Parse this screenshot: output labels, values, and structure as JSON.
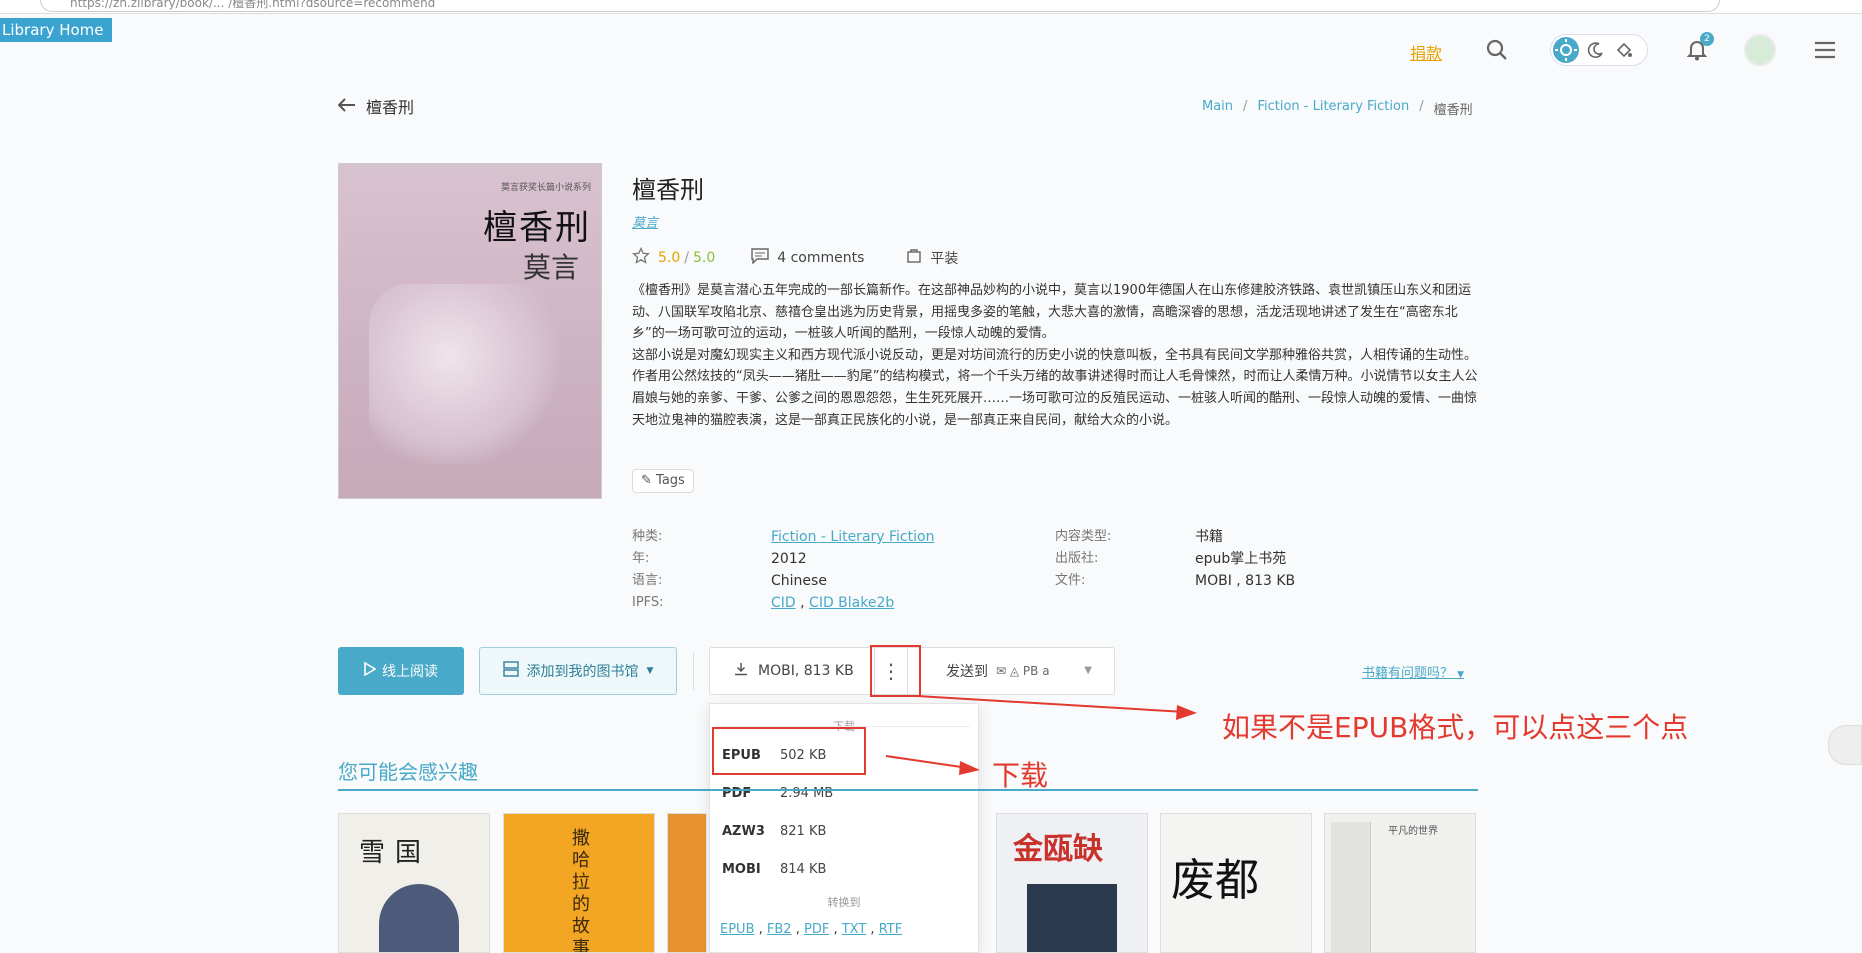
{
  "browser": {
    "url": "https://zh.zlibrary/book/... /檀香刑.html?dsource=recommend"
  },
  "library_home": "Library Home",
  "header": {
    "donate": "捐款",
    "notification_count": "2"
  },
  "page": {
    "back_title": "檀香刑",
    "breadcrumb": [
      "Main",
      "Fiction - Literary Fiction",
      "檀香刑"
    ]
  },
  "book": {
    "cover": {
      "top_text": "莫言获奖长篇小说系列",
      "title": "檀香刑",
      "author_sig": "莫言"
    },
    "title": "檀香刑",
    "author": "莫言",
    "rating": "5.0",
    "rating_sep": "/",
    "rating2": "5.0",
    "comments": "4 comments",
    "format_label": "平装",
    "description": [
      "《檀香刑》是莫言潜心五年完成的一部长篇新作。在这部神品妙构的小说中，莫言以1900年德国人在山东修建胶济铁路、袁世凯镇压山东义和团运动、八国联军攻陷北京、慈禧仓皇出逃为历史背景，用摇曳多姿的笔触，大悲大喜的激情，高瞻深睿的思想，活龙活现地讲述了发生在“高密东北乡”的一场可歌可泣的运动，一桩骇人听闻的酷刑，一段惊人动魄的爱情。",
      "这部小说是对魔幻现实主义和西方现代派小说反动，更是对坊间流行的历史小说的快意叫板，全书具有民间文学那种雅俗共赏，人相传诵的生动性。作者用公然炫技的“凤头——猪肚——豹尾”的结构模式，将一个千头万绪的故事讲述得时而让人毛骨悚然，时而让人柔情万种。小说情节以女主人公眉娘与她的亲爹、干爹、公爹之间的恩恩怨怨，生生死死展开……一场可歌可泣的反殖民运动、一桩骇人听闻的酷刑、一段惊人动魄的爱情、一曲惊天地泣鬼神的猫腔表演，这是一部真正民族化的小说，是一部真正来自民间，献给大众的小说。"
    ],
    "tags_label": "Tags",
    "props_left": {
      "category_label": "种类:",
      "category_value": "Fiction - Literary Fiction",
      "year_label": "年:",
      "year_value": "2012",
      "language_label": "语言:",
      "language_value": "Chinese",
      "ipfs_label": "IPFS:",
      "ipfs_cid": "CID",
      "ipfs_sep": " , ",
      "ipfs_blake": "CID Blake2b"
    },
    "props_right": {
      "content_type_label": "内容类型:",
      "content_type_value": "书籍",
      "publisher_label": "出版社:",
      "publisher_value": "epub掌上书苑",
      "file_label": "文件:",
      "file_value": "MOBI , 813 KB"
    }
  },
  "actions": {
    "read_online": "线上阅读",
    "add_to_shelf": "添加到我的图书馆",
    "download": "MOBI, 813 KB",
    "send_to": "发送到",
    "send_targets": "✉ ◬ PB a",
    "problem": "书籍有问题吗？"
  },
  "dropdown": {
    "header": "下载",
    "items": [
      {
        "format": "EPUB",
        "size": "502 KB"
      },
      {
        "format": "PDF",
        "size": "2.94 MB"
      },
      {
        "format": "AZW3",
        "size": "821 KB"
      },
      {
        "format": "MOBI",
        "size": "814 KB"
      }
    ],
    "convert_header": "转换到",
    "convert_links": [
      "EPUB",
      "FB2",
      "PDF",
      "TXT",
      "RTF"
    ]
  },
  "annotations": {
    "dots_hint": "如果不是EPUB格式，可以点这三个点",
    "download_hint": "下载"
  },
  "related": {
    "title": "您可能会感兴趣",
    "books": [
      {
        "title": "雪国"
      },
      {
        "title": "撒哈拉的故事"
      },
      {
        "title": ""
      },
      {
        "title": "金瓯缺"
      },
      {
        "title": "废都"
      },
      {
        "title": "平凡的世界"
      }
    ]
  },
  "colors": {
    "accent": "#49a9c9",
    "annotation": "#e33a2f",
    "donate": "#e5a200"
  }
}
